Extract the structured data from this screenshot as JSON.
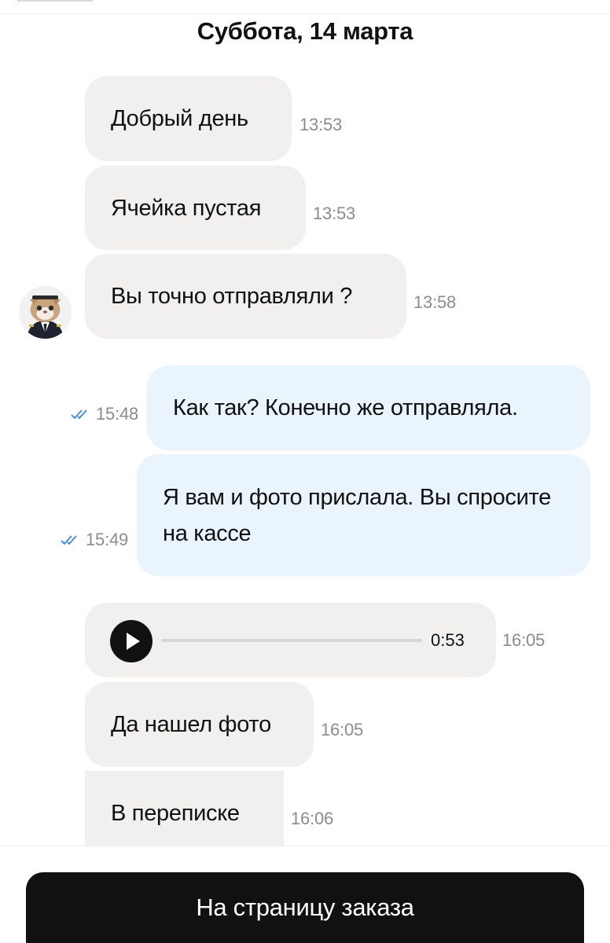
{
  "date_header": "Суббота, 14 марта",
  "messages": [
    {
      "text": "Добрый день",
      "time": "13:53",
      "direction": "incoming"
    },
    {
      "text": "Ячейка пустая",
      "time": "13:53",
      "direction": "incoming"
    },
    {
      "text": "Вы точно отправляли ?",
      "time": "13:58",
      "direction": "incoming"
    },
    {
      "text": "Как так? Конечно же отправляла.",
      "time": "15:48",
      "direction": "outgoing",
      "status": "read"
    },
    {
      "text": "Я вам и фото прислала. Вы спросите на кассе",
      "time": "15:49",
      "direction": "outgoing",
      "status": "read"
    },
    {
      "type": "voice",
      "duration": "0:53",
      "time": "16:05",
      "direction": "incoming",
      "progress": 0
    },
    {
      "text": "Да нашел фото",
      "time": "16:05",
      "direction": "incoming"
    },
    {
      "text": "В переписке",
      "time": "16:06",
      "direction": "incoming"
    }
  ],
  "order_button_label": "На страницу заказа",
  "icons": {
    "read_checks": "double-check-icon",
    "play": "play-icon",
    "avatar": "cat-pilot-avatar"
  },
  "colors": {
    "incoming_bubble": "#f1f0ee",
    "outgoing_bubble": "#e9f4fd",
    "read_check": "#4a90d9",
    "button": "#111111"
  }
}
